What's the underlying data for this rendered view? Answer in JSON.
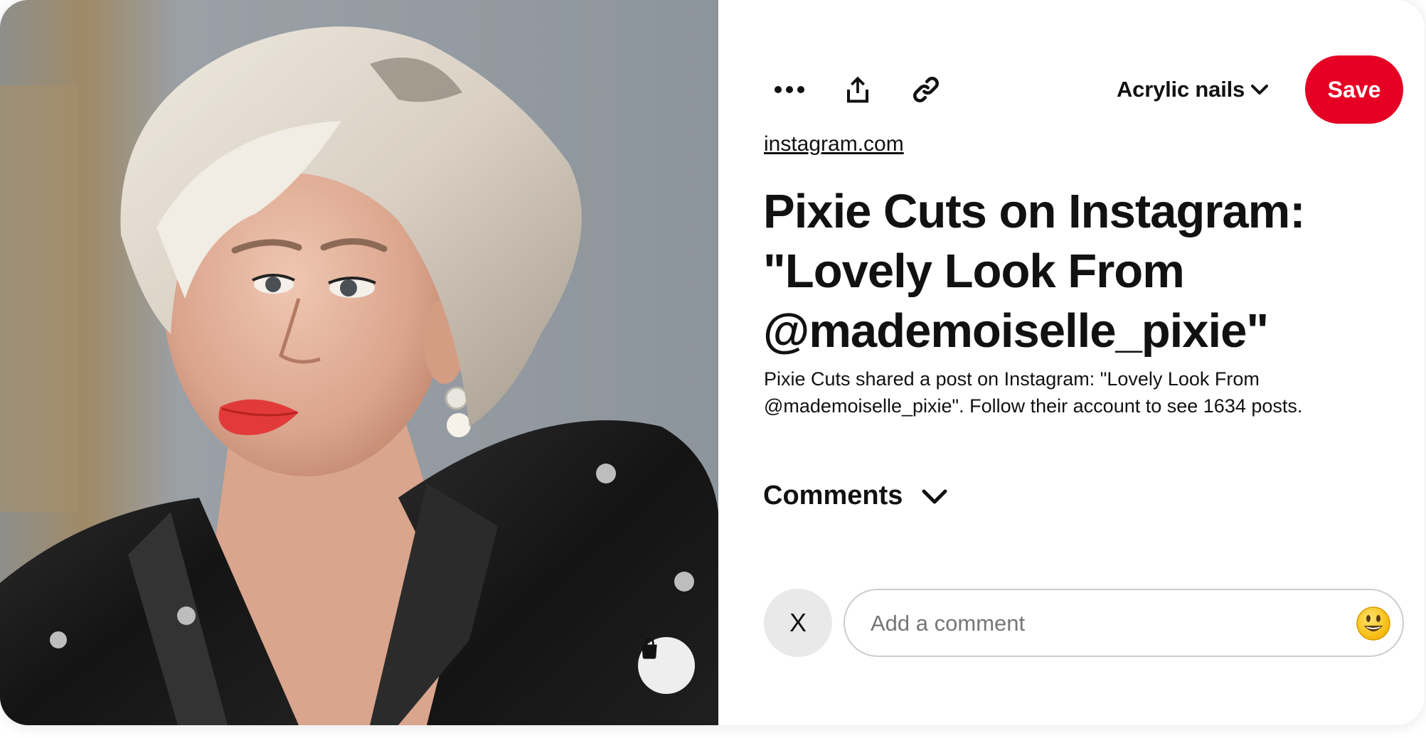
{
  "toolbar": {
    "more_icon": "more-horizontal-icon",
    "share_icon": "share-upload-icon",
    "link_icon": "link-icon",
    "board_name": "Acrylic nails",
    "board_dropdown_icon": "chevron-down-icon",
    "save_label": "Save"
  },
  "pin": {
    "source": "instagram.com",
    "title": "Pixie Cuts on Instagram: \"Lovely Look From @mademoiselle_pixie\"",
    "description": "Pixie Cuts shared a post on Instagram: \"Lovely Look From @mademoiselle_pixie\". Follow their account to see 1634 posts."
  },
  "image": {
    "shop_icon": "shopping-bag-icon"
  },
  "comments": {
    "label": "Comments",
    "toggle_icon": "chevron-down-icon",
    "avatar_initial": "X",
    "placeholder": "Add a comment",
    "emoji_icon": "smiley-emoji-icon"
  },
  "colors": {
    "save_button": "#e60023",
    "text": "#111111",
    "placeholder": "#767676"
  }
}
